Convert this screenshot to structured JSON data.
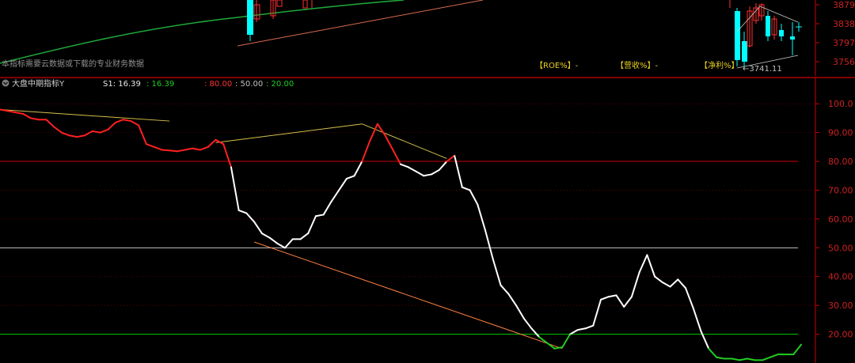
{
  "top_panel": {
    "notice": "本指标需要云数据或下载的专业财务数据",
    "fin_labels": [
      "【ROE%】-",
      "【营收%】-",
      "【净利%】"
    ],
    "y_ticks": [
      "3879",
      "3838",
      "3797",
      "3756"
    ],
    "low_label": "←3741.11"
  },
  "indicator": {
    "name": "大盘中期指标Y",
    "s1_label": "S1: 16.39",
    "s1_value": ": 16.39",
    "level_high": ": 80.00",
    "level_mid": ": 50.00",
    "level_low": ": 20.00"
  },
  "colors": {
    "background": "#000000",
    "line_normal": "#ffffff",
    "line_high": "#ff2020",
    "line_low": "#22cc22",
    "ref_high": "#cc0000",
    "ref_mid": "#c0c0c0",
    "ref_low": "#00cc00",
    "axis": "#cc0000",
    "tick_text": "#cc2222",
    "trend_yellow": "#d4c04a",
    "trend_orange": "#ff8040"
  },
  "chart_data": {
    "type": "line",
    "ylim": [
      10,
      105
    ],
    "y_ticks": [
      "100.0",
      "90.00",
      "80.00",
      "70.00",
      "60.00",
      "50.00",
      "40.00",
      "30.00",
      "20.00"
    ],
    "y_tick_values": [
      100,
      90,
      80,
      70,
      60,
      50,
      40,
      30,
      20
    ],
    "reference_lines": [
      80,
      50,
      20
    ],
    "n_points": 105,
    "series": [
      {
        "values": [
          98,
          97.5,
          97,
          96.5,
          95,
          94.5,
          94.5,
          92,
          90,
          89,
          88.5,
          89,
          90.5,
          90,
          91,
          93.5,
          94.5,
          94,
          92.5,
          86,
          85,
          84,
          83.8,
          83.5,
          84,
          84.5,
          84,
          85,
          87.5,
          86,
          78,
          63,
          62,
          59,
          55,
          53.5,
          51.5,
          50,
          53,
          53,
          55,
          61,
          61.5,
          66,
          70,
          74,
          75,
          80,
          87,
          93,
          89,
          84,
          79,
          78,
          76.5,
          75,
          75.5,
          77,
          80,
          82,
          71,
          70,
          65,
          56,
          46,
          37,
          34,
          30,
          25.5,
          22,
          19,
          17,
          15,
          15.5,
          20,
          21.5,
          22,
          23,
          32,
          33,
          33.5,
          29.5,
          33,
          41.5,
          47.5,
          40,
          38,
          36.5,
          39,
          36,
          29,
          21,
          15,
          12,
          11.5,
          11.5,
          11,
          11.5,
          11,
          11,
          12,
          13,
          13,
          13,
          16.39
        ]
      }
    ],
    "trendlines": [
      {
        "color": "yellow",
        "x": [
          0,
          22
        ],
        "y": [
          98,
          94
        ]
      },
      {
        "color": "yellow",
        "x": [
          28,
          47
        ],
        "y": [
          86.5,
          93
        ]
      },
      {
        "color": "yellow",
        "x": [
          47,
          58
        ],
        "y": [
          93,
          81
        ]
      },
      {
        "color": "orange",
        "x": [
          33,
          73
        ],
        "y": [
          52,
          15
        ]
      }
    ]
  }
}
